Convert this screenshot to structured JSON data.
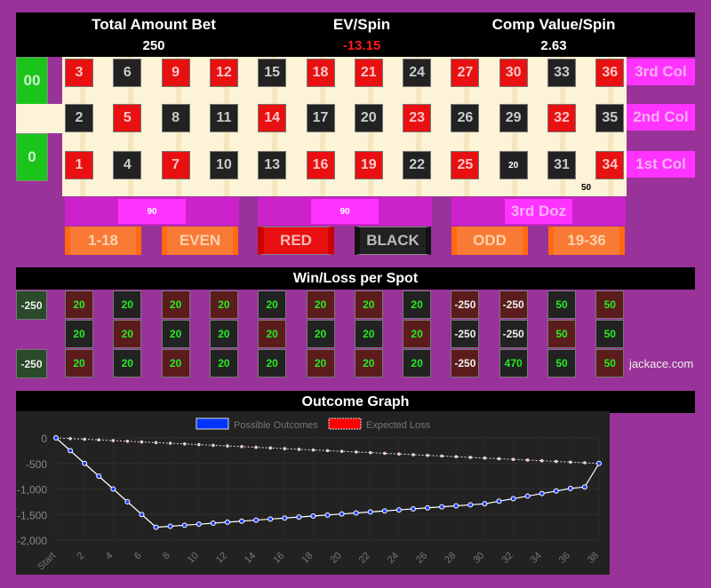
{
  "header": {
    "total_bet_label": "Total Amount Bet",
    "total_bet": "250",
    "ev_label": "EV/Spin",
    "ev": "-13.15",
    "comp_label": "Comp Value/Spin",
    "comp": "2.63"
  },
  "zeros": [
    "00",
    "0"
  ],
  "numbers": {
    "top": [
      {
        "n": "3",
        "c": "red"
      },
      {
        "n": "6",
        "c": "blk"
      },
      {
        "n": "9",
        "c": "red"
      },
      {
        "n": "12",
        "c": "red"
      },
      {
        "n": "15",
        "c": "blk"
      },
      {
        "n": "18",
        "c": "red"
      },
      {
        "n": "21",
        "c": "red"
      },
      {
        "n": "24",
        "c": "blk"
      },
      {
        "n": "27",
        "c": "red"
      },
      {
        "n": "30",
        "c": "red"
      },
      {
        "n": "33",
        "c": "blk"
      },
      {
        "n": "36",
        "c": "red"
      }
    ],
    "mid": [
      {
        "n": "2",
        "c": "blk"
      },
      {
        "n": "5",
        "c": "red"
      },
      {
        "n": "8",
        "c": "blk"
      },
      {
        "n": "11",
        "c": "blk"
      },
      {
        "n": "14",
        "c": "red"
      },
      {
        "n": "17",
        "c": "blk"
      },
      {
        "n": "20",
        "c": "blk"
      },
      {
        "n": "23",
        "c": "red"
      },
      {
        "n": "26",
        "c": "blk"
      },
      {
        "n": "29",
        "c": "blk"
      },
      {
        "n": "32",
        "c": "red"
      },
      {
        "n": "35",
        "c": "blk"
      }
    ],
    "bot": [
      {
        "n": "1",
        "c": "red"
      },
      {
        "n": "4",
        "c": "blk"
      },
      {
        "n": "7",
        "c": "red"
      },
      {
        "n": "10",
        "c": "blk"
      },
      {
        "n": "13",
        "c": "blk"
      },
      {
        "n": "16",
        "c": "red"
      },
      {
        "n": "19",
        "c": "red"
      },
      {
        "n": "22",
        "c": "blk"
      },
      {
        "n": "25",
        "c": "red"
      },
      {
        "n": "20",
        "c": "blk",
        "chip": true
      },
      {
        "n": "31",
        "c": "blk"
      },
      {
        "n": "34",
        "c": "red"
      }
    ]
  },
  "chips": {
    "split_31_34": "50"
  },
  "columns": [
    "3rd Col",
    "2nd Col",
    "1st Col"
  ],
  "dozens": [
    "90",
    "90",
    "3rd Doz"
  ],
  "even_bets": [
    "1-18",
    "EVEN",
    "RED",
    "BLACK",
    "ODD",
    "19-36"
  ],
  "winloss": {
    "title": "Win/Loss per Spot",
    "zeros": [
      "-250",
      "-250"
    ],
    "top": [
      "20",
      "20",
      "20",
      "20",
      "20",
      "20",
      "20",
      "20",
      "-250",
      "-250",
      "50",
      "50"
    ],
    "mid": [
      "20",
      "20",
      "20",
      "20",
      "20",
      "20",
      "20",
      "20",
      "-250",
      "-250",
      "50",
      "50"
    ],
    "bot": [
      "20",
      "20",
      "20",
      "20",
      "20",
      "20",
      "20",
      "20",
      "-250",
      "470",
      "50",
      "50"
    ],
    "brand": "jackace.com"
  },
  "graph_title": "Outcome Graph",
  "chart_data": {
    "type": "line",
    "title": "Outcome Graph",
    "legend": [
      "Possible Outcomes",
      "Expected Loss"
    ],
    "legend_position": "top",
    "x": [
      "Start",
      1,
      2,
      3,
      4,
      5,
      6,
      7,
      8,
      9,
      10,
      11,
      12,
      13,
      14,
      15,
      16,
      17,
      18,
      19,
      20,
      21,
      22,
      23,
      24,
      25,
      26,
      27,
      28,
      29,
      30,
      31,
      32,
      33,
      34,
      35,
      36,
      37,
      38
    ],
    "x_tick_labels": [
      "Start",
      "2",
      "4",
      "6",
      "8",
      "10",
      "12",
      "14",
      "16",
      "18",
      "20",
      "22",
      "24",
      "26",
      "28",
      "30",
      "32",
      "34",
      "36",
      "38"
    ],
    "y_tick_labels": [
      "0",
      "-500",
      "-1,000",
      "-1,500",
      "-2,000"
    ],
    "ylim": [
      -2000,
      0
    ],
    "series": [
      {
        "name": "Possible Outcomes",
        "color": "#0033ff",
        "values": [
          0,
          -250,
          -500,
          -750,
          -1000,
          -1250,
          -1500,
          -1750,
          -1730,
          -1710,
          -1690,
          -1670,
          -1650,
          -1630,
          -1610,
          -1590,
          -1570,
          -1550,
          -1530,
          -1510,
          -1490,
          -1470,
          -1450,
          -1430,
          -1410,
          -1390,
          -1370,
          -1350,
          -1330,
          -1310,
          -1290,
          -1240,
          -1190,
          -1140,
          -1090,
          -1040,
          -990,
          -960,
          -500
        ]
      },
      {
        "name": "Expected Loss",
        "color": "#ff0000",
        "values": [
          0,
          -13,
          -26,
          -39,
          -53,
          -66,
          -79,
          -92,
          -105,
          -118,
          -132,
          -145,
          -158,
          -171,
          -184,
          -197,
          -210,
          -224,
          -237,
          -250,
          -263,
          -276,
          -289,
          -303,
          -316,
          -329,
          -342,
          -355,
          -368,
          -382,
          -395,
          -408,
          -421,
          -434,
          -447,
          -461,
          -474,
          -487,
          -500
        ]
      }
    ]
  }
}
